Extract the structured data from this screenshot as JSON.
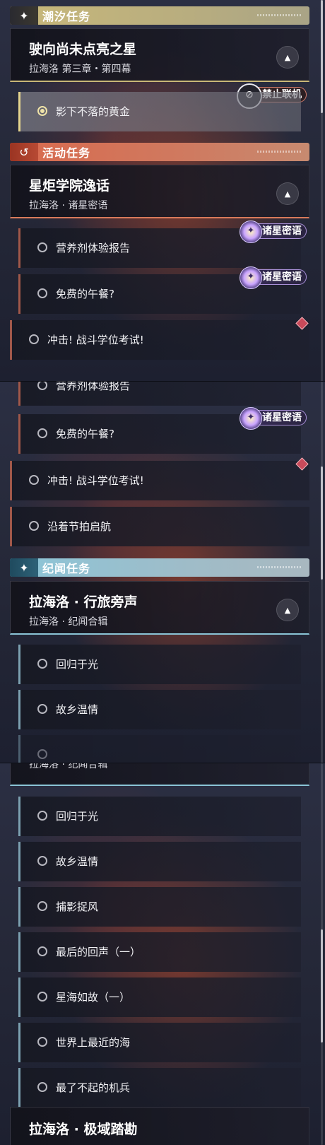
{
  "categories": {
    "tide": {
      "label": "潮汐任务",
      "icon": "sparkle-icon",
      "color": "#c8b87a"
    },
    "event": {
      "label": "活动任务",
      "icon": "event-return-icon",
      "color": "#d96a4e"
    },
    "chronicle": {
      "label": "纪闻任务",
      "icon": "sparkle-icon",
      "color": "#8cc5d8"
    }
  },
  "tide_quest": {
    "title": "驶向尚未点亮之星",
    "subtitle": "拉海洛 第三章・第四幕",
    "coop_badge": "禁止联机",
    "sub_items": [
      "影下不落的黄金"
    ]
  },
  "event_quest": {
    "title": "星炬学院逸话",
    "subtitle": "拉海洛 · 诸星密语",
    "badge": "诸星密语",
    "sub_items": [
      "营养剂体验报告",
      "免费的午餐?",
      "冲击! 战斗学位考试!",
      "沿着节拍启航"
    ]
  },
  "chronicle_quest": {
    "title": "拉海洛 · 行旅旁声",
    "subtitle": "拉海洛 · 纪闻合辑",
    "sub_items": [
      "回归于光",
      "故乡温情",
      "捕影捉风",
      "最后的回声（一）",
      "星海如故（一）",
      "世界上最近的海",
      "最了不起的机兵"
    ]
  },
  "next_quest": {
    "title": "拉海洛 · 极域踏勘"
  },
  "partial": {
    "p2_top": "营养剂体验报告",
    "p3_top": "拉海洛 · 纪闻合辑"
  },
  "scroll": {
    "p1": 0.0,
    "p2": 0.45,
    "p3": 0.9
  }
}
